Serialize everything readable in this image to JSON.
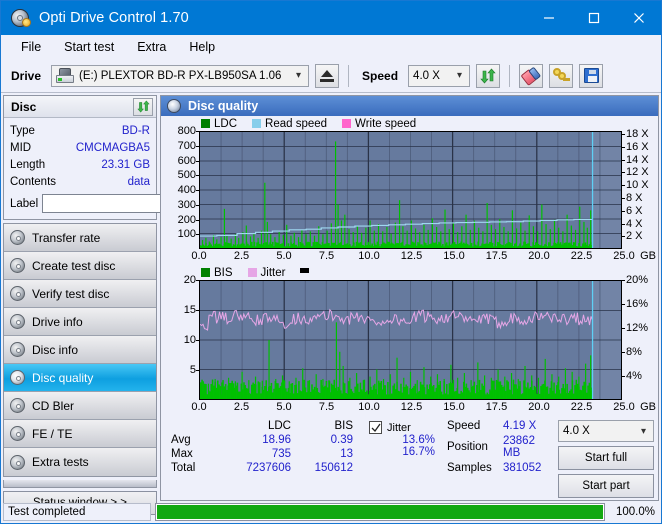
{
  "window": {
    "title": "Opti Drive Control 1.70",
    "icon": "disc-burn-icon",
    "controls": {
      "minimize": "minimize-icon",
      "maximize": "maximize-icon",
      "close": "close-icon"
    }
  },
  "menu": {
    "items": [
      "File",
      "Start test",
      "Extra",
      "Help"
    ]
  },
  "toolbar": {
    "drive_label": "Drive",
    "drive_value": "(E:)   PLEXTOR BD-R  PX-LB950SA 1.06",
    "eject_icon": "eject-icon",
    "speed_label": "Speed",
    "speed_value": "4.0 X",
    "refresh_icon": "refresh-icon",
    "erase_icon": "eraser-icon",
    "key_icon": "keys-icon",
    "save_icon": "save-floppy-icon"
  },
  "disc_panel": {
    "title": "Disc",
    "refresh_icon": "refresh-icon",
    "rows": [
      {
        "key": "Type",
        "value": "BD-R"
      },
      {
        "key": "MID",
        "value": "CMCMAGBA5"
      },
      {
        "key": "Length",
        "value": "23.31 GB"
      },
      {
        "key": "Contents",
        "value": "data"
      }
    ],
    "label_key": "Label",
    "label_value": "",
    "label_placeholder": "",
    "disc_icon": "cd-disc-icon"
  },
  "sidebar": {
    "items": [
      {
        "label": "Transfer rate",
        "icon": "disc-icon",
        "active": false
      },
      {
        "label": "Create test disc",
        "icon": "disc-icon",
        "active": false
      },
      {
        "label": "Verify test disc",
        "icon": "disc-icon",
        "active": false
      },
      {
        "label": "Drive info",
        "icon": "disc-icon",
        "active": false
      },
      {
        "label": "Disc info",
        "icon": "disc-icon",
        "active": false
      },
      {
        "label": "Disc quality",
        "icon": "disc-icon",
        "active": true
      },
      {
        "label": "CD Bler",
        "icon": "disc-icon",
        "active": false
      },
      {
        "label": "FE / TE",
        "icon": "disc-icon",
        "active": false
      },
      {
        "label": "Extra tests",
        "icon": "disc-icon",
        "active": false
      }
    ],
    "status_window_button": "Status window > >"
  },
  "main": {
    "header_title": "Disc quality",
    "header_icon": "disc-quality-icon"
  },
  "chart_data": [
    {
      "type": "line",
      "name": "ldc-read-speed-chart",
      "title": "",
      "legend": [
        {
          "label": "LDC",
          "color": "#008000"
        },
        {
          "label": "Read speed",
          "color": "#87ceeb"
        },
        {
          "label": "Write speed",
          "color": "#ff66cc"
        }
      ],
      "legend_position": "top-left",
      "xlabel": "GB",
      "x_ticks": [
        "0.0",
        "2.5",
        "5.0",
        "7.5",
        "10.0",
        "12.5",
        "15.0",
        "17.5",
        "20.0",
        "22.5",
        "25.0"
      ],
      "xlim": [
        0,
        25
      ],
      "ylabel_left": "LDC",
      "y_ticks_left": [
        "100",
        "200",
        "300",
        "400",
        "500",
        "600",
        "700",
        "800"
      ],
      "ylim_left": [
        0,
        800
      ],
      "ylabel_right": "Speed",
      "y_ticks_right": [
        "2 X",
        "4 X",
        "6 X",
        "8 X",
        "10 X",
        "12 X",
        "14 X",
        "16 X",
        "18 X"
      ],
      "ylim_right": [
        0,
        18.5
      ],
      "grid": true,
      "data_end_gb": 23.31,
      "series": [
        {
          "name": "LDC",
          "color": "#00c000",
          "type": "spike-bars",
          "baseline": 30,
          "spikes": [
            [
              0.15,
              55
            ],
            [
              0.35,
              70
            ],
            [
              0.55,
              45
            ],
            [
              0.8,
              90
            ],
            [
              1.0,
              60
            ],
            [
              1.25,
              75
            ],
            [
              1.45,
              270
            ],
            [
              1.6,
              85
            ],
            [
              1.85,
              65
            ],
            [
              2.1,
              95
            ],
            [
              2.3,
              70
            ],
            [
              2.55,
              110
            ],
            [
              2.75,
              155
            ],
            [
              3.0,
              80
            ],
            [
              3.2,
              100
            ],
            [
              3.45,
              70
            ],
            [
              3.65,
              120
            ],
            [
              3.85,
              450
            ],
            [
              4.0,
              180
            ],
            [
              4.2,
              95
            ],
            [
              4.45,
              75
            ],
            [
              4.7,
              110
            ],
            [
              4.95,
              90
            ],
            [
              5.15,
              160
            ],
            [
              5.4,
              85
            ],
            [
              5.6,
              105
            ],
            [
              5.85,
              75
            ],
            [
              6.05,
              125
            ],
            [
              6.3,
              95
            ],
            [
              6.55,
              115
            ],
            [
              6.8,
              85
            ],
            [
              7.05,
              150
            ],
            [
              7.3,
              95
            ],
            [
              7.55,
              120
            ],
            [
              7.8,
              170
            ],
            [
              8.05,
              735
            ],
            [
              8.2,
              300
            ],
            [
              8.4,
              190
            ],
            [
              8.6,
              230
            ],
            [
              8.85,
              130
            ],
            [
              9.1,
              110
            ],
            [
              9.35,
              150
            ],
            [
              9.6,
              105
            ],
            [
              9.85,
              140
            ],
            [
              10.1,
              190
            ],
            [
              10.35,
              120
            ],
            [
              10.6,
              165
            ],
            [
              10.85,
              115
            ],
            [
              11.1,
              145
            ],
            [
              11.35,
              100
            ],
            [
              11.6,
              175
            ],
            [
              11.85,
              330
            ],
            [
              12.05,
              150
            ],
            [
              12.3,
              120
            ],
            [
              12.55,
              190
            ],
            [
              12.8,
              135
            ],
            [
              13.05,
              110
            ],
            [
              13.3,
              160
            ],
            [
              13.55,
              125
            ],
            [
              13.8,
              205
            ],
            [
              14.05,
              145
            ],
            [
              14.3,
              115
            ],
            [
              14.55,
              265
            ],
            [
              14.8,
              130
            ],
            [
              15.05,
              175
            ],
            [
              15.3,
              110
            ],
            [
              15.55,
              150
            ],
            [
              15.8,
              230
            ],
            [
              16.05,
              125
            ],
            [
              16.3,
              190
            ],
            [
              16.55,
              140
            ],
            [
              16.8,
              115
            ],
            [
              17.05,
              310
            ],
            [
              17.3,
              160
            ],
            [
              17.55,
              130
            ],
            [
              17.8,
              200
            ],
            [
              18.05,
              145
            ],
            [
              18.3,
              115
            ],
            [
              18.55,
              260
            ],
            [
              18.8,
              135
            ],
            [
              19.05,
              175
            ],
            [
              19.3,
              120
            ],
            [
              19.55,
              225
            ],
            [
              19.8,
              150
            ],
            [
              20.05,
              115
            ],
            [
              20.3,
              300
            ],
            [
              20.55,
              165
            ],
            [
              20.8,
              130
            ],
            [
              21.05,
              195
            ],
            [
              21.3,
              140
            ],
            [
              21.55,
              115
            ],
            [
              21.8,
              230
            ],
            [
              22.05,
              155
            ],
            [
              22.3,
              125
            ],
            [
              22.55,
              285
            ],
            [
              22.8,
              180
            ],
            [
              23.0,
              140
            ],
            [
              23.2,
              260
            ]
          ]
        },
        {
          "name": "Read speed",
          "color": "#9fd8f0",
          "type": "step-line",
          "points": [
            [
              0.0,
              1.9
            ],
            [
              1.0,
              2.0
            ],
            [
              2.2,
              2.3
            ],
            [
              3.3,
              2.5
            ],
            [
              4.3,
              2.7
            ],
            [
              5.3,
              2.9
            ],
            [
              6.3,
              3.0
            ],
            [
              7.2,
              3.2
            ],
            [
              8.2,
              3.35
            ],
            [
              9.2,
              3.5
            ],
            [
              10.2,
              3.6
            ],
            [
              11.2,
              3.7
            ],
            [
              12.2,
              3.8
            ],
            [
              13.2,
              3.9
            ],
            [
              14.2,
              4.0
            ],
            [
              15.2,
              4.05
            ],
            [
              16.2,
              4.1
            ],
            [
              17.2,
              4.15
            ],
            [
              18.2,
              4.2
            ],
            [
              19.2,
              4.3
            ],
            [
              20.2,
              4.4
            ],
            [
              21.2,
              4.5
            ],
            [
              22.2,
              4.55
            ],
            [
              23.3,
              4.6
            ]
          ]
        }
      ]
    },
    {
      "type": "line",
      "name": "bis-jitter-chart",
      "title": "",
      "legend": [
        {
          "label": "BIS",
          "color": "#008000"
        },
        {
          "label": "Jitter",
          "color": "#e6a6e6"
        },
        {
          "label": "",
          "color": "#000000"
        }
      ],
      "legend_position": "top-left",
      "xlabel": "GB",
      "x_ticks": [
        "0.0",
        "2.5",
        "5.0",
        "7.5",
        "10.0",
        "12.5",
        "15.0",
        "17.5",
        "20.0",
        "22.5",
        "25.0"
      ],
      "xlim": [
        0,
        25
      ],
      "ylabel_left": "BIS",
      "y_ticks_left": [
        "5",
        "10",
        "15",
        "20"
      ],
      "ylim_left": [
        0,
        20
      ],
      "ylabel_right": "Jitter",
      "y_ticks_right": [
        "4%",
        "8%",
        "12%",
        "16%",
        "20%"
      ],
      "ylim_right": [
        0,
        20
      ],
      "grid": true,
      "data_end_gb": 23.31,
      "series": [
        {
          "name": "BIS",
          "color": "#00c000",
          "type": "spike-bars",
          "baseline": 2.2,
          "spikes": [
            [
              0.2,
              3.0
            ],
            [
              0.5,
              2.6
            ],
            [
              0.9,
              3.4
            ],
            [
              1.3,
              2.8
            ],
            [
              1.7,
              3.6
            ],
            [
              2.1,
              3.0
            ],
            [
              2.5,
              4.6
            ],
            [
              2.9,
              3.2
            ],
            [
              3.3,
              3.8
            ],
            [
              3.7,
              3.1
            ],
            [
              4.1,
              10.0
            ],
            [
              4.5,
              3.4
            ],
            [
              4.9,
              4.0
            ],
            [
              5.3,
              3.0
            ],
            [
              5.7,
              3.6
            ],
            [
              6.1,
              5.2
            ],
            [
              6.5,
              3.2
            ],
            [
              6.9,
              4.2
            ],
            [
              7.3,
              3.4
            ],
            [
              7.7,
              3.0
            ],
            [
              8.1,
              13.0
            ],
            [
              8.3,
              8.0
            ],
            [
              8.5,
              5.6
            ],
            [
              8.9,
              3.6
            ],
            [
              9.3,
              4.4
            ],
            [
              9.7,
              3.2
            ],
            [
              10.1,
              3.8
            ],
            [
              10.5,
              5.0
            ],
            [
              10.9,
              3.4
            ],
            [
              11.3,
              4.2
            ],
            [
              11.7,
              7.0
            ],
            [
              12.1,
              3.6
            ],
            [
              12.5,
              4.6
            ],
            [
              12.9,
              3.2
            ],
            [
              13.3,
              5.4
            ],
            [
              13.7,
              3.8
            ],
            [
              14.1,
              4.2
            ],
            [
              14.5,
              3.4
            ],
            [
              14.9,
              5.8
            ],
            [
              15.3,
              3.6
            ],
            [
              15.7,
              4.4
            ],
            [
              16.1,
              3.2
            ],
            [
              16.5,
              6.2
            ],
            [
              16.9,
              4.0
            ],
            [
              17.3,
              3.6
            ],
            [
              17.7,
              5.0
            ],
            [
              18.1,
              3.8
            ],
            [
              18.5,
              4.4
            ],
            [
              18.9,
              3.4
            ],
            [
              19.3,
              5.6
            ],
            [
              19.7,
              4.0
            ],
            [
              20.1,
              3.6
            ],
            [
              20.5,
              6.8
            ],
            [
              20.9,
              4.2
            ],
            [
              21.3,
              3.8
            ],
            [
              21.7,
              5.2
            ],
            [
              22.1,
              4.6
            ],
            [
              22.5,
              3.8
            ],
            [
              22.9,
              6.0
            ],
            [
              23.2,
              7.4
            ]
          ]
        },
        {
          "name": "Jitter",
          "color": "#e6a6e6",
          "type": "noisy-line",
          "mean": 13.6,
          "min": 11.5,
          "max": 16.7,
          "unit": "%"
        }
      ]
    }
  ],
  "stats": {
    "columns": [
      "",
      "LDC",
      "BIS"
    ],
    "rows": [
      {
        "label": "Avg",
        "ldc": "18.96",
        "bis": "0.39"
      },
      {
        "label": "Max",
        "ldc": "735",
        "bis": "13"
      },
      {
        "label": "Total",
        "ldc": "7237606",
        "bis": "150612"
      }
    ]
  },
  "jitter_panel": {
    "checkbox_checked": true,
    "label": "Jitter",
    "avg": "13.6%",
    "max": "16.7%"
  },
  "readout": {
    "speed_label": "Speed",
    "speed_value": "4.19 X",
    "position_label": "Position",
    "position_value": "23862 MB",
    "samples_label": "Samples",
    "samples_value": "381052"
  },
  "actions": {
    "speed_select": "4.0 X",
    "start_full": "Start full",
    "start_part": "Start part"
  },
  "statusbar": {
    "text": "Test completed",
    "progress": 100,
    "progress_text": "100.0%"
  },
  "colors": {
    "titlebar": "#0078d4",
    "accent_value": "#2222cc",
    "plot_bg": "#667a9e",
    "ldc_green": "#00c000",
    "read_speed": "#9fd8f0",
    "write_speed": "#ff66cc",
    "jitter_pink": "#e6a6e6",
    "progress_green": "#12a812",
    "active_nav": "#0e9fe0"
  }
}
